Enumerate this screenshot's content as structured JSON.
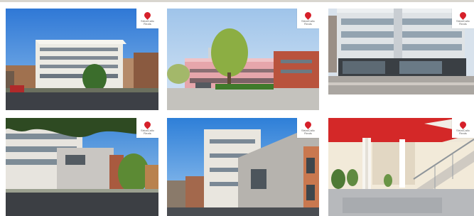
{
  "gallery": {
    "brand": {
      "name": "StrialCalic",
      "tagline": "Reals",
      "accent": "#d6202a"
    },
    "photos": [
      {
        "name": "Building exterior with blue sky",
        "has_logo": true
      },
      {
        "name": "Building with green tree",
        "has_logo": true
      },
      {
        "name": "Office facade corner",
        "has_logo": true
      },
      {
        "name": "Building exterior with tree branch",
        "has_logo": true
      },
      {
        "name": "Modern annex building",
        "has_logo": true
      },
      {
        "name": "Lobby interior with red ceiling",
        "has_logo": true
      }
    ]
  }
}
